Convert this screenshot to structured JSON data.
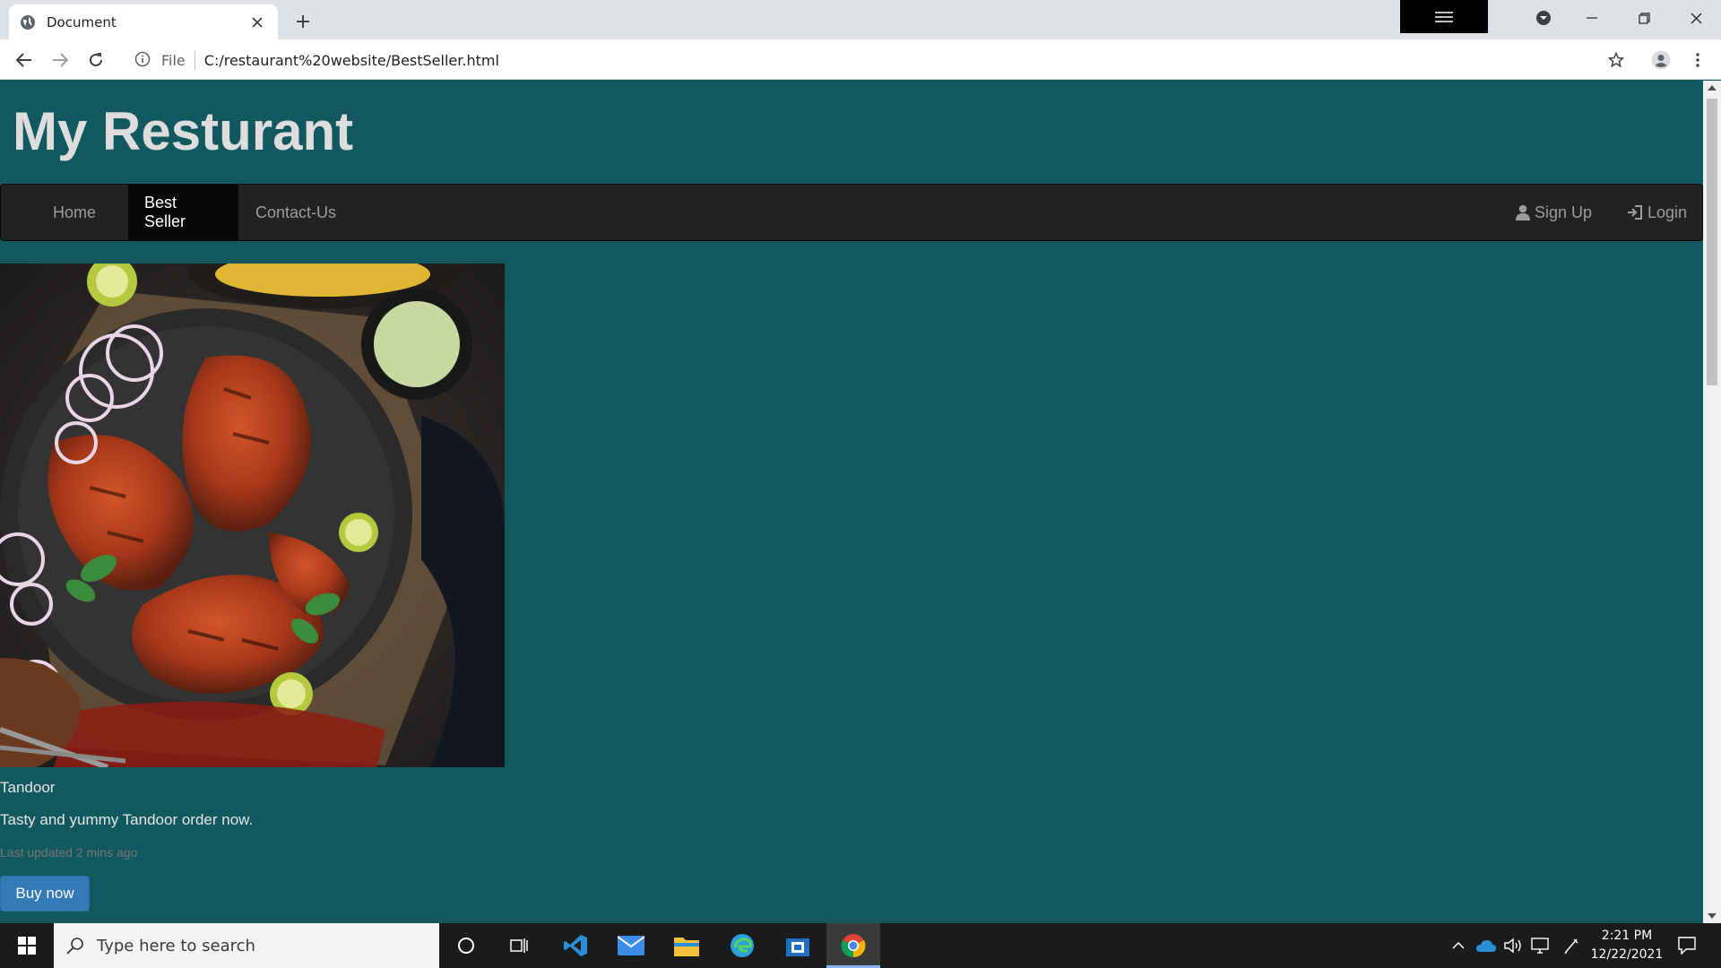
{
  "browser": {
    "tab_title": "Document",
    "address_scheme": "File",
    "address_url": "C:/restaurant%20website/BestSeller.html"
  },
  "site": {
    "title": "My Resturant",
    "nav": {
      "items": [
        {
          "label": "Home"
        },
        {
          "label": "Best Seller",
          "active": true
        },
        {
          "label": "Contact-Us"
        }
      ],
      "right": [
        {
          "label": "Sign Up",
          "icon": "user-icon"
        },
        {
          "label": "Login",
          "icon": "login-icon"
        }
      ]
    },
    "card": {
      "name": "Tandoor",
      "description": "Tasty and yummy Tandoor order now.",
      "updated": "Last updated 2 mins ago",
      "button": "Buy now"
    }
  },
  "taskbar": {
    "search_placeholder": "Type here to search",
    "time": "2:21 PM",
    "date": "12/22/2021"
  },
  "colors": {
    "page_background": "#11585f",
    "navbar": "#222222",
    "button": "#337ab7"
  }
}
